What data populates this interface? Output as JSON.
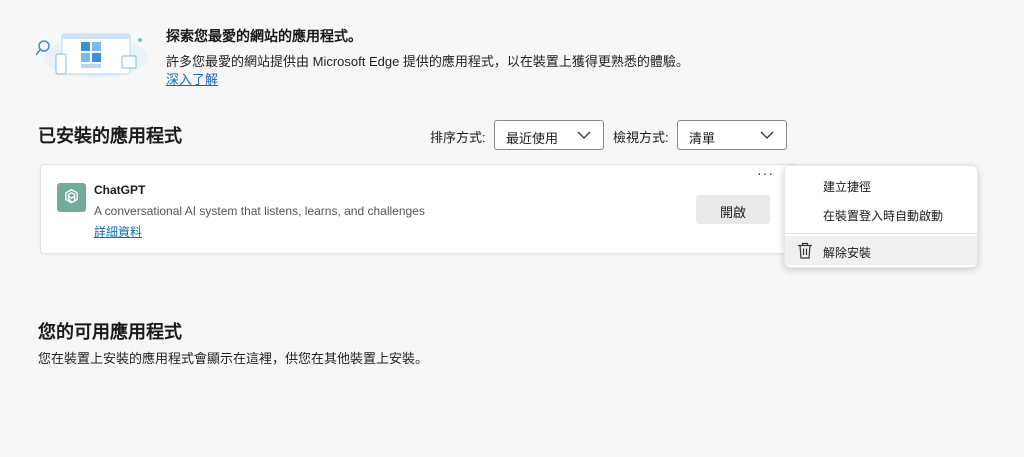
{
  "banner": {
    "title": "探索您最愛的網站的應用程式。",
    "description": "許多您最愛的網站提供由 Microsoft Edge 提供的應用程式，以在裝置上獲得更熟悉的體驗。",
    "learn_more": "深入了解"
  },
  "installed": {
    "heading": "已安裝的應用程式",
    "sort_label": "排序方式:",
    "sort_value": "最近使用",
    "view_label": "檢視方式:",
    "view_value": "清單"
  },
  "app": {
    "name": "ChatGPT",
    "description": "A conversational AI system that listens, learns, and challenges",
    "details_link": "詳細資料",
    "open_label": "開啟",
    "more_label": "···",
    "icon": "chatgpt-logo"
  },
  "context_menu": {
    "items": [
      {
        "label": "建立捷徑"
      },
      {
        "label": "在裝置登入時自動啟動"
      },
      {
        "label": "解除安裝",
        "icon": "trash-icon"
      }
    ]
  },
  "available": {
    "heading": "您的可用應用程式",
    "description": "您在裝置上安裝的應用程式會顯示在這裡，供您在其他裝置上安裝。"
  },
  "colors": {
    "background": "#f7f7f7",
    "link": "#0f6cbd",
    "app_icon_bg": "#74aa9c",
    "illustration_blue": "#3b8fd9"
  }
}
